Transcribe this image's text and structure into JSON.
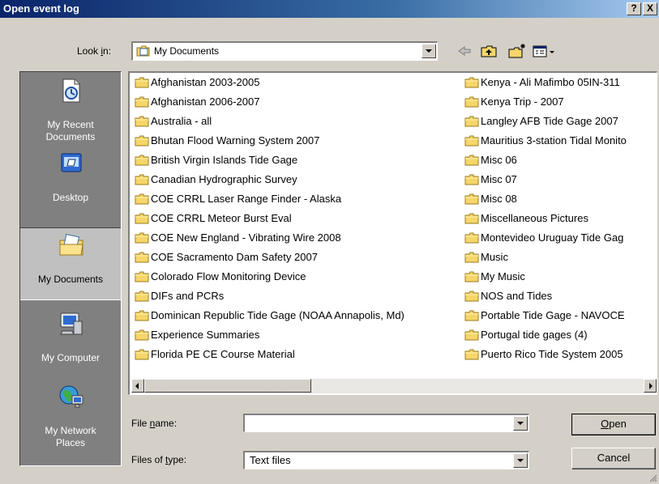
{
  "window": {
    "title": "Open event log"
  },
  "titlebar": {
    "help_label": "?",
    "close_label": "X"
  },
  "lookin": {
    "label_pre": "Look ",
    "label_key": "i",
    "label_post": "n:",
    "value": "My Documents"
  },
  "places": [
    {
      "line1": "My Recent",
      "line2": "Documents",
      "icon": "recent-documents-icon"
    },
    {
      "line1": "Desktop",
      "line2": "",
      "icon": "desktop-icon"
    },
    {
      "line1": "My Documents",
      "line2": "",
      "icon": "my-documents-icon",
      "active": true
    },
    {
      "line1": "My Computer",
      "line2": "",
      "icon": "my-computer-icon"
    },
    {
      "line1": "My Network",
      "line2": "Places",
      "icon": "network-places-icon"
    }
  ],
  "files": {
    "left": [
      "Afghanistan 2003-2005",
      "Afghanistan 2006-2007",
      "Australia - all",
      "Bhutan Flood Warning System 2007",
      "British Virgin Islands Tide Gage",
      "Canadian Hydrographic Survey",
      "COE CRRL Laser Range Finder - Alaska",
      "COE CRRL Meteor Burst Eval",
      "COE New England - Vibrating Wire 2008",
      "COE Sacramento Dam Safety 2007",
      "Colorado Flow Monitoring Device",
      "DIFs and PCRs",
      "Dominican Republic Tide Gage (NOAA Annapolis, Md)",
      "Experience Summaries",
      "Florida PE CE Course Material"
    ],
    "right": [
      "Kenya - Ali Mafimbo 05IN-311",
      "Kenya Trip - 2007",
      "Langley AFB Tide Gage 2007",
      "Mauritius 3-station Tidal Monito",
      "Misc 06",
      "Misc 07",
      "Misc 08",
      "Miscellaneous Pictures",
      "Montevideo Uruguay Tide Gag",
      "Music",
      "My Music",
      "NOS and Tides",
      "Portable Tide Gage - NAVOCE",
      "Portugal tide gages (4)",
      "Puerto Rico Tide System 2005"
    ]
  },
  "filename": {
    "label_pre": "File ",
    "label_key": "n",
    "label_post": "ame:",
    "value": ""
  },
  "filetype": {
    "label_pre": "Files of ",
    "label_key": "t",
    "label_post": "ype:",
    "value": "Text files"
  },
  "buttons": {
    "open_key": "O",
    "open_rest": "pen",
    "cancel": "Cancel"
  },
  "colors": {
    "title_bar": "#0a246a",
    "face": "#d4d0c8",
    "places_bg": "#808080",
    "folder": "#f6d66a"
  }
}
